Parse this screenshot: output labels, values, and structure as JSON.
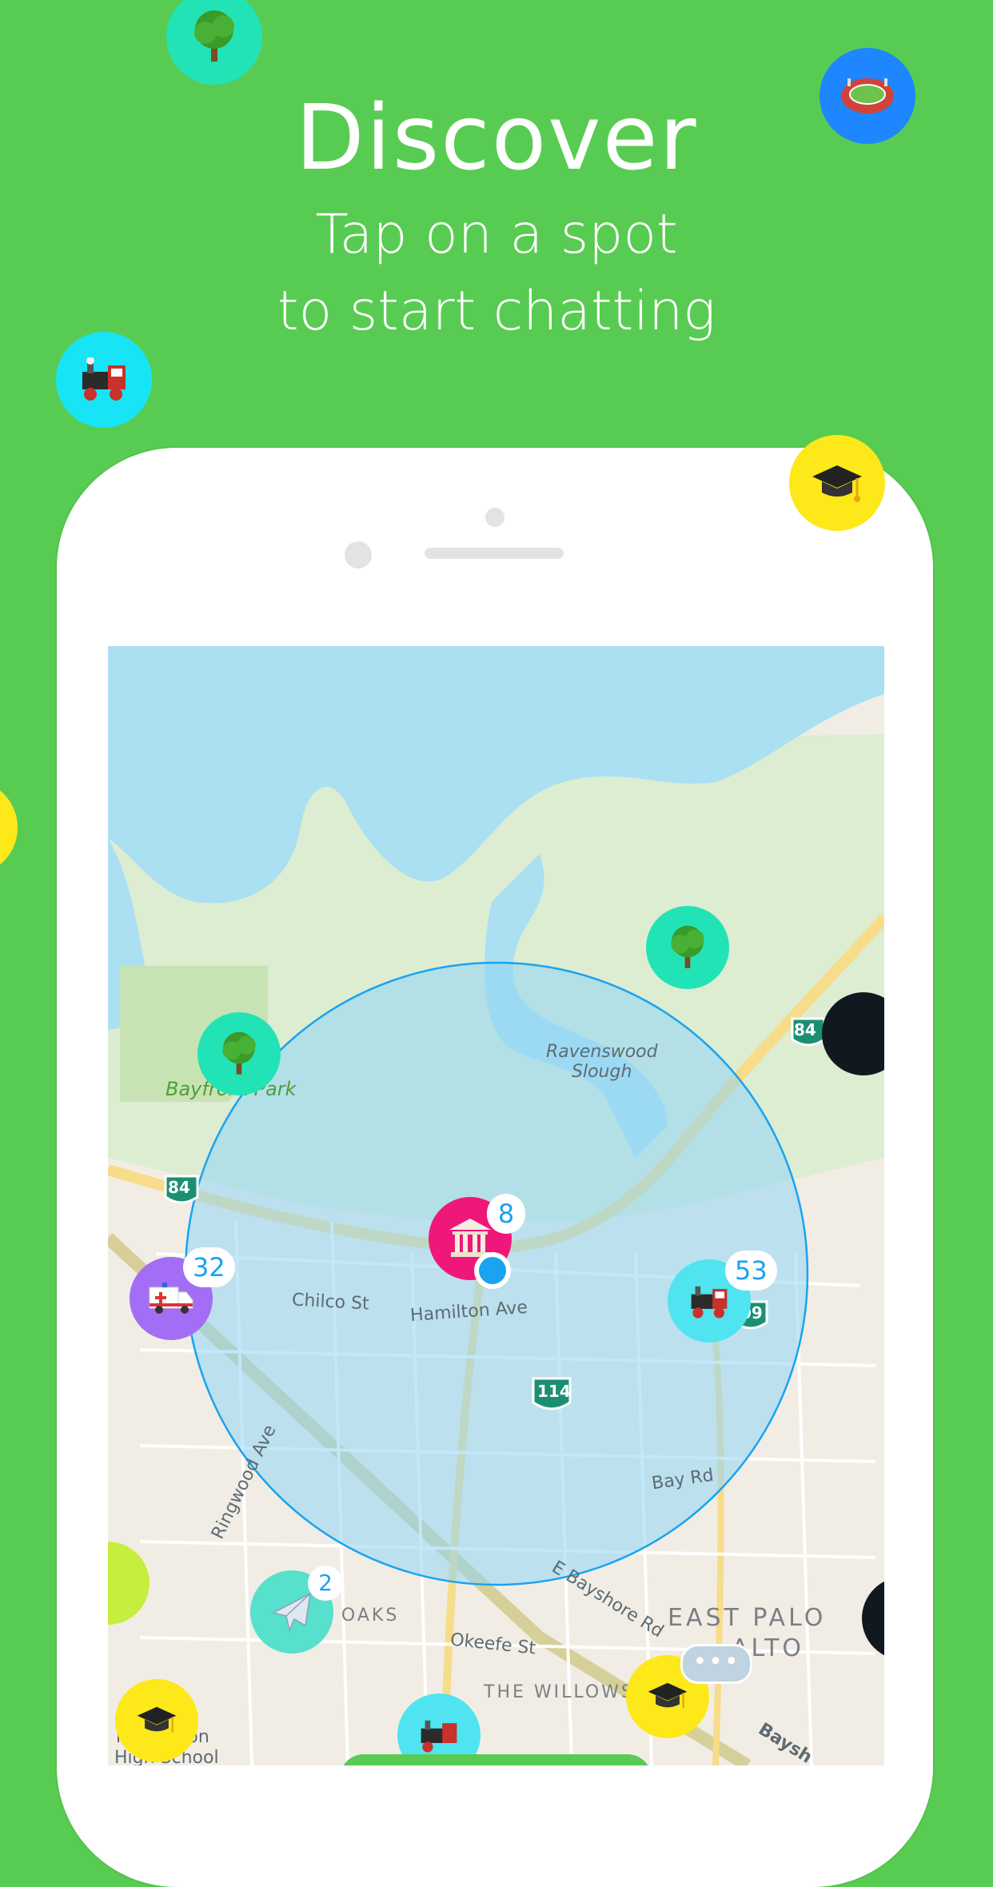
{
  "header": {
    "title": "Discover",
    "subtitle_line1": "Tap on a spot",
    "subtitle_line2": "to start chatting"
  },
  "colors": {
    "background": "#58cc52",
    "water": "#abdff2",
    "radius_fill": "#8fd6f5",
    "radius_stroke": "#1aa3f0",
    "user_dot": "#1aa3f0"
  },
  "floating_spots": [
    {
      "name": "park-spot-top",
      "icon": "tree-icon",
      "color": "#22e3b5"
    },
    {
      "name": "stadium-spot",
      "icon": "stadium-icon",
      "color": "#1e86ff"
    },
    {
      "name": "train-spot-left",
      "icon": "train-icon",
      "color": "#17e5f5"
    },
    {
      "name": "school-spot-phone-corner",
      "icon": "graduation-cap-icon",
      "color": "#fde81a"
    },
    {
      "name": "school-spot-edge",
      "icon": "graduation-cap-icon",
      "color": "#fde81a"
    }
  ],
  "map": {
    "labels": {
      "bayfront_park": "Bayfront Park",
      "ravenswood_1": "Ravenswood",
      "ravenswood_2": "Slough",
      "chilco": "Chilco St",
      "hamilton": "Hamilton Ave",
      "bay_rd": "Bay Rd",
      "ringwood": "Ringwood Ave",
      "okeefe": "Okeefe St",
      "bayshore": "E Bayshore Rd",
      "east_palo_1": "EAST PALO",
      "east_palo_2": "ALTO",
      "willows": "THE WILLOWS",
      "oaks": "D OAKS",
      "atherton_1": "n Atherton",
      "atherton_2": "High School",
      "bays": "Baysh",
      "hwy_84_left": "84",
      "hwy_84_right": "84",
      "hwy_114": "114",
      "hwy_109": "09"
    },
    "spots": [
      {
        "name": "museum-spot",
        "icon": "museum-icon",
        "color": "#f0177a",
        "count": "8"
      },
      {
        "name": "ambulance-spot",
        "icon": "ambulance-icon",
        "color": "#a36ef5",
        "count": "32"
      },
      {
        "name": "train-spot-map",
        "icon": "train-icon",
        "color": "#4fe4f0",
        "count": "53"
      },
      {
        "name": "airport-spot",
        "icon": "airplane-icon",
        "color": "#57e0cc",
        "count": "2"
      },
      {
        "name": "park-spot-map-1",
        "icon": "tree-icon",
        "color": "#22e3b5",
        "count": ""
      },
      {
        "name": "park-spot-map-2",
        "icon": "tree-icon",
        "color": "#22e3b5",
        "count": ""
      }
    ],
    "typing_indicator": "•••"
  }
}
